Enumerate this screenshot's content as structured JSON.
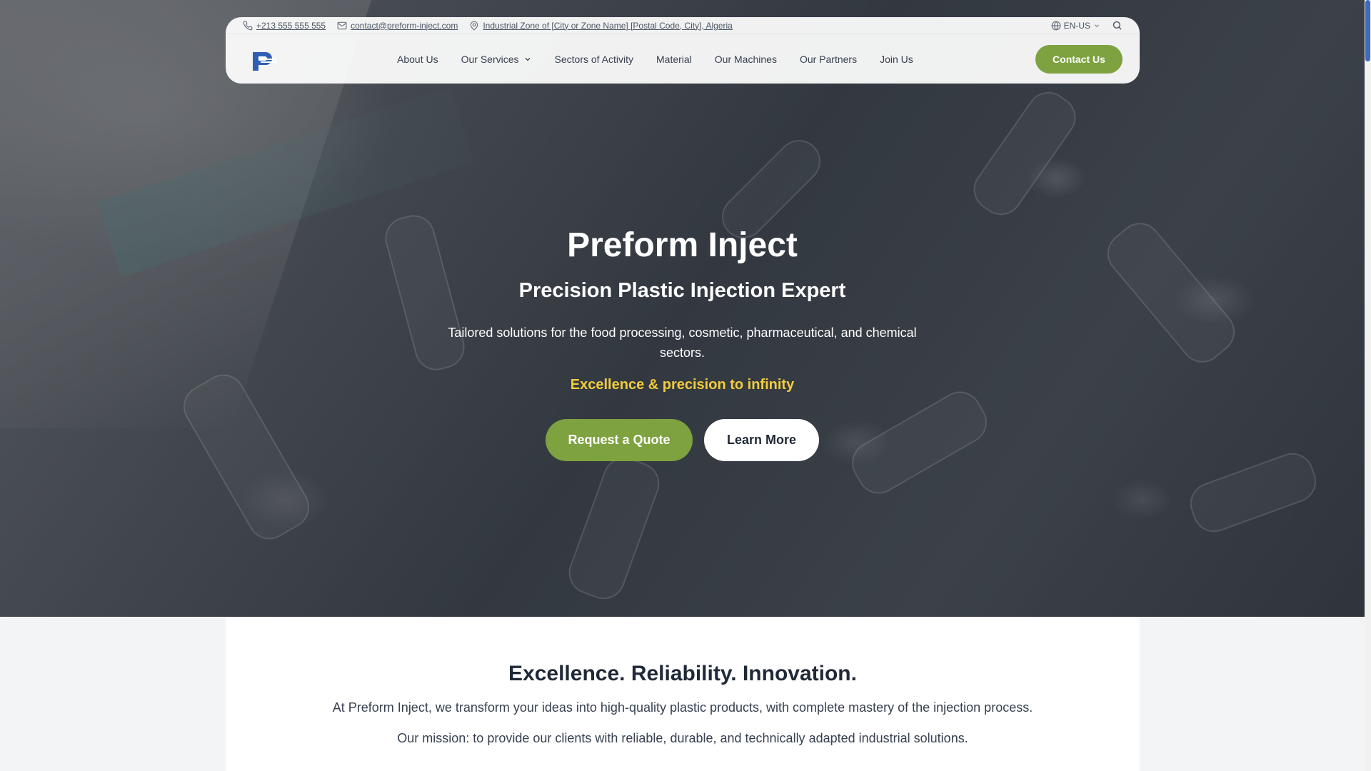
{
  "topbar": {
    "phone": "+213 555 555 555",
    "email": "contact@preform-inject.com",
    "address": "Industrial Zone of [City or Zone Name] [Postal Code, City], Algeria",
    "language": "EN-US"
  },
  "nav": {
    "items": [
      "About Us",
      "Our Services",
      "Sectors of Activity",
      "Material",
      "Our Machines",
      "Our Partners",
      "Join Us"
    ],
    "contact_label": "Contact Us"
  },
  "hero": {
    "title": "Preform Inject",
    "subtitle": "Precision Plastic Injection Expert",
    "description": "Tailored solutions for the food processing, cosmetic, pharmaceutical, and chemical sectors.",
    "tagline": "Excellence & precision to infinity",
    "quote_button": "Request a Quote",
    "learn_button": "Learn More"
  },
  "intro": {
    "heading": "Excellence. Reliability. Innovation.",
    "paragraph1": "At Preform Inject, we transform your ideas into high-quality plastic products, with complete mastery of the injection process.",
    "paragraph2": "Our mission: to provide our clients with reliable, durable, and technically adapted industrial solutions."
  },
  "colors": {
    "accent": "#7ea23f",
    "tagline": "#f2cc3a",
    "logo": "#2f5fb3"
  }
}
